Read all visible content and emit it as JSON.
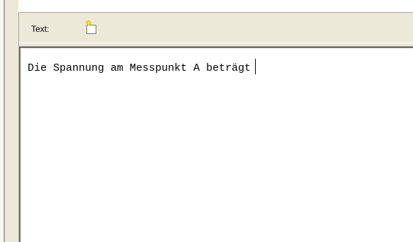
{
  "toolbar": {
    "label": "Text:",
    "new_button_icon": "new-document-icon"
  },
  "editor": {
    "content": "Die Spannung am Messpunkt A beträgt"
  },
  "colors": {
    "toolbar_bg": "#ece9d8",
    "border": "#a7a6aa",
    "editor_bg": "#ffffff",
    "icon_star": "#f5d000"
  }
}
